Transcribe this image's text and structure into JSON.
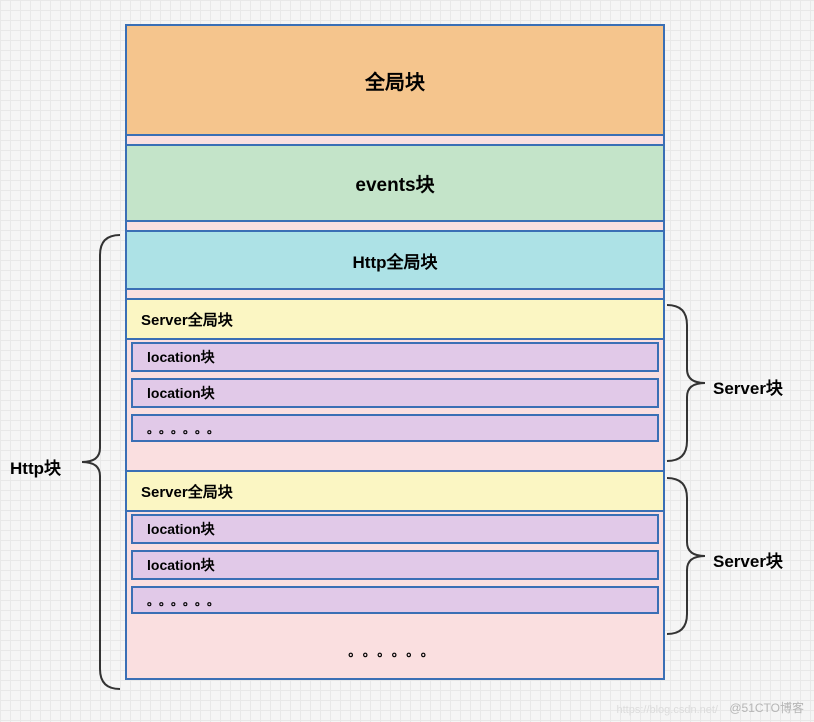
{
  "blocks": {
    "global": "全局块",
    "events": "events块",
    "http_global": "Http全局块",
    "server_global": "Server全局块",
    "location": "location块",
    "dots_small": "。。。。。。",
    "dots_big": "。。。。。。"
  },
  "labels": {
    "http_block": "Http块",
    "server_block": "Server块"
  },
  "watermark": "@51CTO博客",
  "watermark2": "https://blog.csdn.net/"
}
